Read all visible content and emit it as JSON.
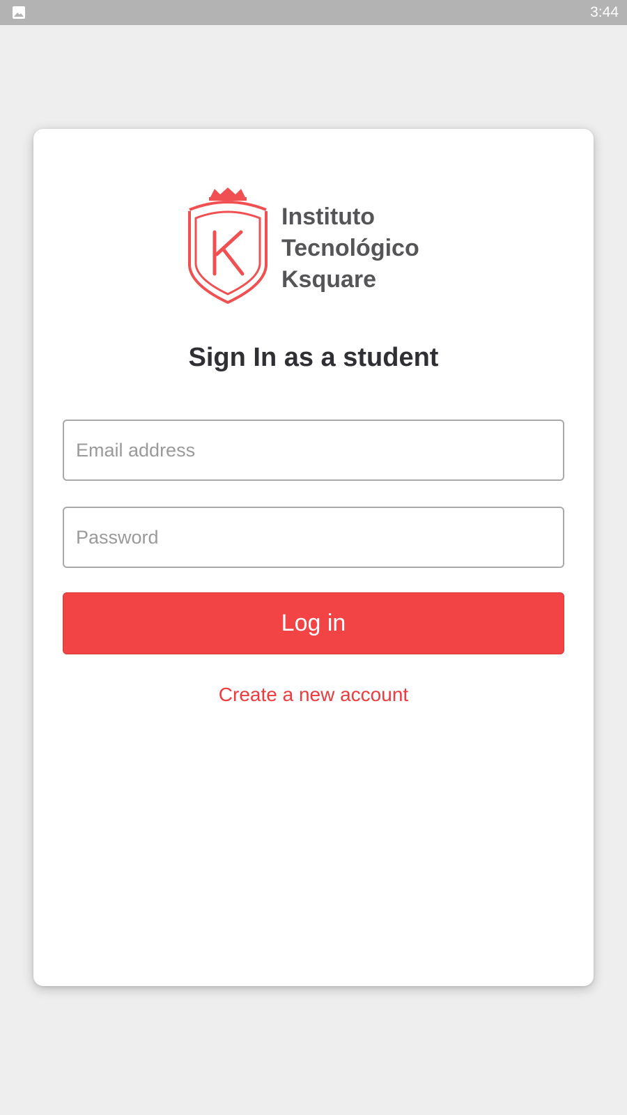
{
  "status_bar": {
    "time": "3:44",
    "notification_icon": "image-icon"
  },
  "logo": {
    "icon": "k-shield-crown-icon",
    "lines": [
      "Instituto",
      "Tecnológico",
      "Ksquare"
    ],
    "brand_color": "#f05052",
    "text_color": "#555558"
  },
  "login": {
    "title": "Sign In as a student",
    "email_placeholder": "Email address",
    "password_placeholder": "Password",
    "login_label": "Log in",
    "create_account_label": "Create a new account"
  },
  "colors": {
    "accent": "#f24345",
    "background": "#eeeeee",
    "status_bar": "#b3b3b3",
    "card": "#ffffff"
  }
}
